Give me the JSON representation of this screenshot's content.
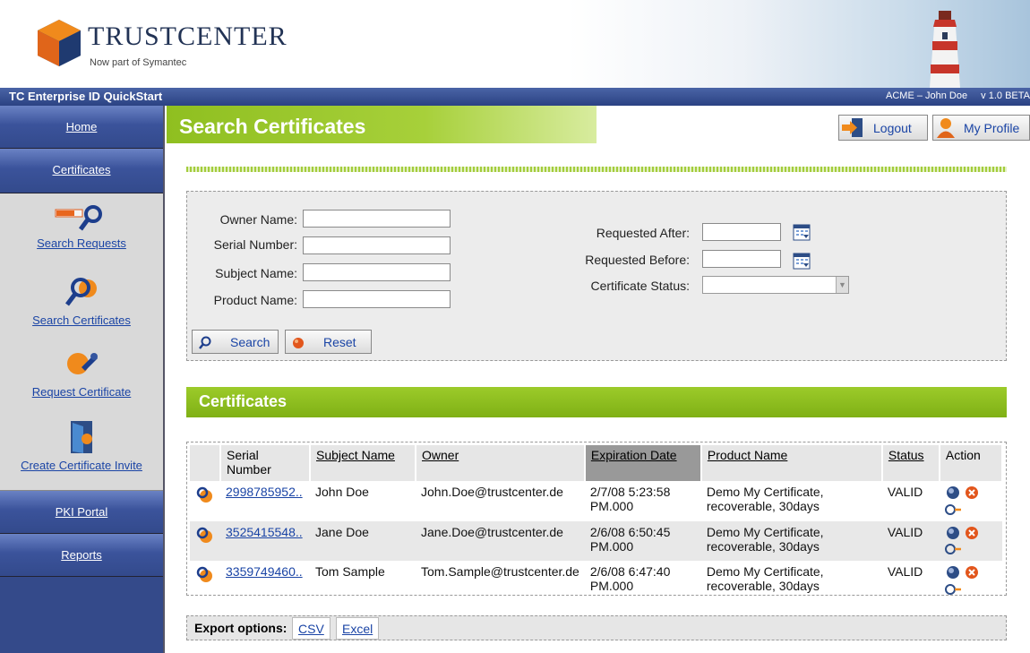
{
  "brand": {
    "logo_word_first": "TRUST",
    "logo_word_second": "CENTER",
    "tagline": "Now part of Symantec"
  },
  "titlebar": {
    "app_title": "TC Enterprise ID QuickStart",
    "user": "ACME – John Doe",
    "version": "v 1.0 BETA"
  },
  "sidebar": {
    "home": "Home",
    "certificates": "Certificates",
    "sub_items": [
      {
        "label": "Search Requests",
        "icon": "search-requests-icon"
      },
      {
        "label": "Search Certificates",
        "icon": "search-certificates-icon"
      },
      {
        "label": "Request Certificate",
        "icon": "request-certificate-icon"
      },
      {
        "label": "Create Certificate Invite",
        "icon": "certificate-invite-icon"
      }
    ],
    "pki_portal": "PKI Portal",
    "reports": "Reports"
  },
  "page": {
    "title": "Search Certificates",
    "logout": "Logout",
    "my_profile": "My Profile"
  },
  "search_form": {
    "owner_name_label": "Owner Name:",
    "serial_number_label": "Serial Number:",
    "subject_name_label": "Subject Name:",
    "product_name_label": "Product Name:",
    "requested_after_label": "Requested After:",
    "requested_before_label": "Requested Before:",
    "certificate_status_label": "Certificate Status:",
    "owner_name_value": "",
    "serial_number_value": "",
    "subject_name_value": "",
    "product_name_value": "",
    "requested_after_value": "",
    "requested_before_value": "",
    "certificate_status_value": "",
    "search_button": "Search",
    "reset_button": "Reset"
  },
  "certificates": {
    "section_title": "Certificates",
    "columns": [
      "Serial Number",
      "Subject Name",
      "Owner",
      "Expiration Date",
      "Product Name",
      "Status",
      "Action"
    ],
    "rows": [
      {
        "serial": "2998785952..",
        "subject": "John Doe",
        "owner": "John.Doe@trustcenter.de",
        "expiration": "2/7/08 5:23:58 PM.000",
        "product": "Demo My Certificate, recoverable, 30days",
        "status": "VALID"
      },
      {
        "serial": "3525415548..",
        "subject": "Jane Doe",
        "owner": "Jane.Doe@trustcenter.de",
        "expiration": "2/6/08 6:50:45 PM.000",
        "product": "Demo My Certificate, recoverable, 30days",
        "status": "VALID"
      },
      {
        "serial": "3359749460..",
        "subject": "Tom Sample",
        "owner": "Tom.Sample@trustcenter.de",
        "expiration": "2/6/08 6:47:40 PM.000",
        "product": "Demo My Certificate, recoverable, 30days",
        "status": "VALID"
      }
    ]
  },
  "export": {
    "label": "Export options:",
    "csv": "CSV",
    "excel": "Excel"
  },
  "colors": {
    "nav_blue": "#344a8a",
    "accent_green": "#8fbf20",
    "link_blue": "#1a44a5"
  }
}
